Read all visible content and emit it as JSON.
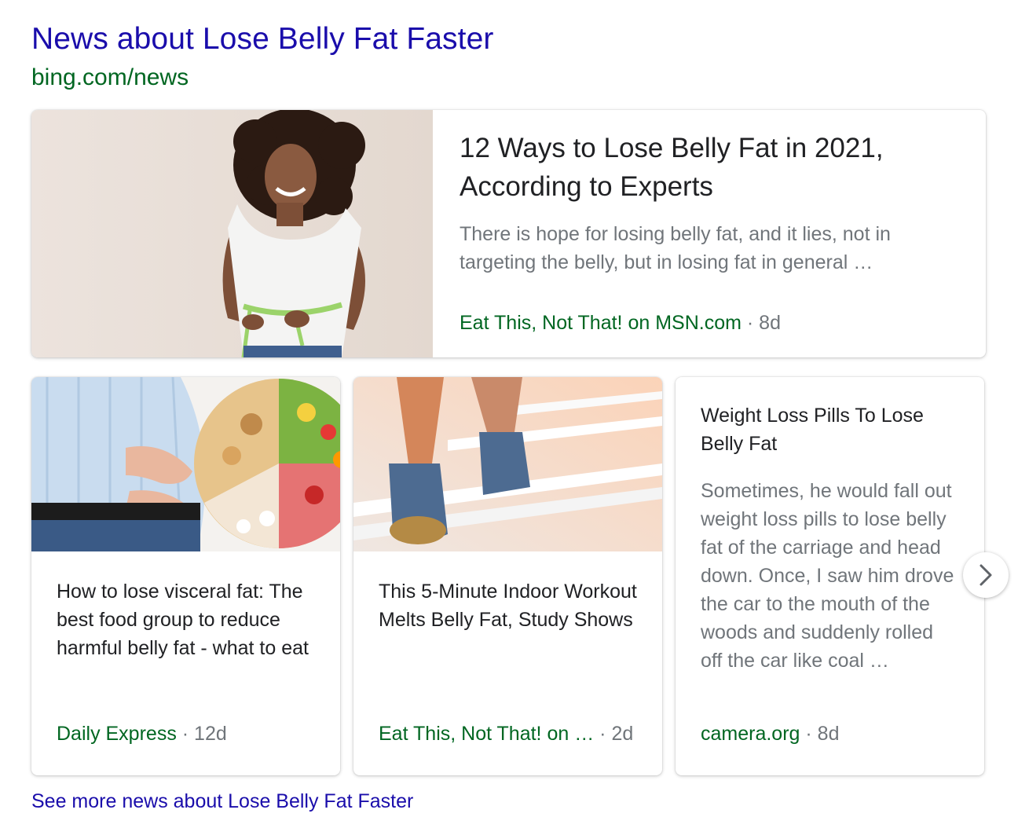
{
  "section": {
    "title": "News about Lose Belly Fat Faster",
    "url": "bing.com/news"
  },
  "top_article": {
    "headline": "12 Ways to Lose Belly Fat in 2021, According to Experts",
    "snippet": "There is hope for losing belly fat, and it lies, not in targeting the belly, but in losing fat in general …",
    "source": "Eat This, Not That! on MSN.com",
    "age": "· 8d"
  },
  "articles": [
    {
      "headline": "How to lose visceral fat: The best food group to reduce harmful belly fat - what to eat",
      "source": "Daily Express",
      "age": "· 12d"
    },
    {
      "headline": "This 5-Minute Indoor Workout Melts Belly Fat, Study Shows",
      "source": "Eat This, Not That! on …",
      "age": "· 2d"
    },
    {
      "headline": "Weight Loss Pills To Lose Belly Fat",
      "snippet": "Sometimes, he would fall out weight loss pills to lose belly fat of the carriage and head down. Once, I saw him drove the car to the mouth of the woods and suddenly rolled off the car like coal …",
      "source": "camera.org",
      "age": "· 8d"
    }
  ],
  "see_more": "See more news about Lose Belly Fat Faster",
  "icons": {
    "next": "chevron-right-icon"
  },
  "colors": {
    "link": "#1a0dab",
    "source": "#006621",
    "muted": "#70757a"
  }
}
